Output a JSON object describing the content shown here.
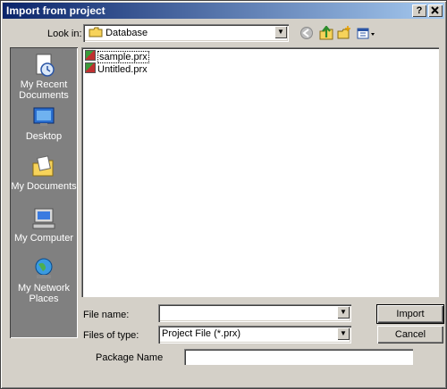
{
  "window": {
    "title": "Import from project",
    "help_label": "?",
    "close_label": "X"
  },
  "look_in": {
    "label": "Look in:",
    "value": "Database"
  },
  "places": [
    {
      "label_line1": "My Recent",
      "label_line2": "Documents",
      "icon": "recent-documents-icon"
    },
    {
      "label_line1": "Desktop",
      "label_line2": "",
      "icon": "desktop-icon"
    },
    {
      "label_line1": "My Documents",
      "label_line2": "",
      "icon": "my-documents-icon"
    },
    {
      "label_line1": "My Computer",
      "label_line2": "",
      "icon": "my-computer-icon"
    },
    {
      "label_line1": "My Network",
      "label_line2": "Places",
      "icon": "network-places-icon"
    }
  ],
  "files": [
    {
      "name": "sample.prx",
      "selected": true
    },
    {
      "name": "Untitled.prx",
      "selected": false
    }
  ],
  "file_name": {
    "label": "File name:",
    "value": ""
  },
  "file_type": {
    "label": "Files of type:",
    "value": "Project File (*.prx)"
  },
  "package_name": {
    "label": "Package Name",
    "value": ""
  },
  "buttons": {
    "import": "Import",
    "cancel": "Cancel"
  },
  "toolbar": {
    "back_icon": "back-icon",
    "up_icon": "up-folder-icon",
    "new_folder_icon": "new-folder-icon",
    "views_icon": "views-menu-icon"
  }
}
